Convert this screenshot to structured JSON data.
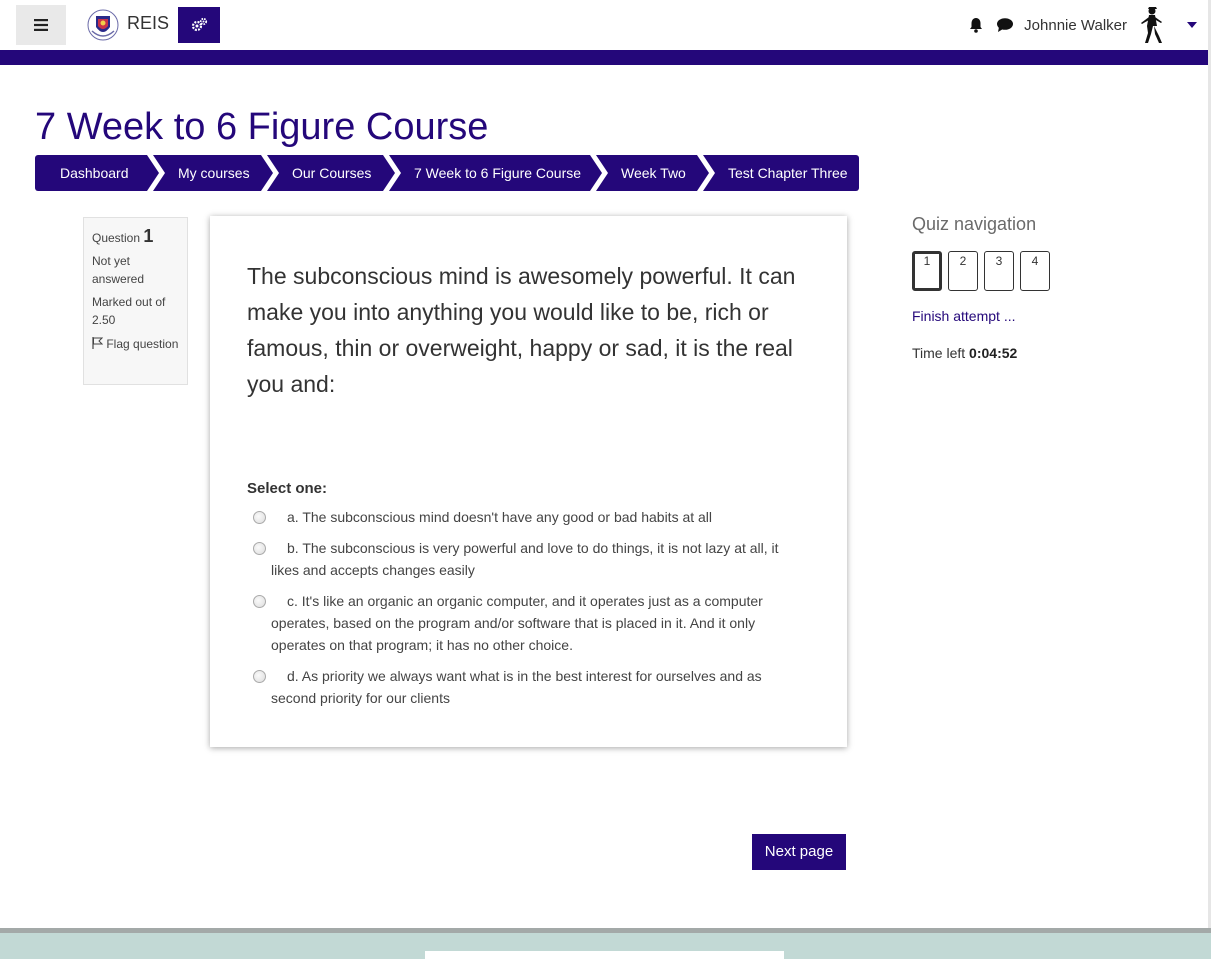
{
  "navbar": {
    "brand_name": "REIS",
    "user_name": "Johnnie Walker"
  },
  "page": {
    "title": "7 Week to 6 Figure Course"
  },
  "breadcrumb": [
    "Dashboard",
    "My courses",
    "Our Courses",
    "7 Week to 6 Figure Course",
    "Week Two",
    "Test Chapter Three"
  ],
  "question_info": {
    "question_label": "Question",
    "question_number": "1",
    "state": "Not yet answered",
    "marks": "Marked out of 2.50",
    "flag_label": "Flag question"
  },
  "question": {
    "text": "The subconscious mind is awesomely powerful. It can make you into anything you would like to be, rich or famous, thin or overweight, happy or sad, it is the real you and:",
    "prompt": "Select one:",
    "answers": [
      "a. The subconscious mind doesn't have any good or bad habits at all",
      "b. The subconscious is very powerful and love to do things, it is not lazy at all, it likes and accepts changes easily",
      "c. It's like an organic an organic computer, and it operates just as a computer operates, based on the program and/or software that is placed in it. And it only operates on that program; it has no other choice.",
      "d. As priority we always want what is in the best interest for ourselves and as second priority for our clients"
    ],
    "next_label": "Next page"
  },
  "quiz_nav": {
    "title": "Quiz navigation",
    "buttons": [
      "1",
      "2",
      "3",
      "4"
    ],
    "current": "1",
    "finish_label": "Finish attempt ...",
    "time_label": "Time left",
    "time_value": "0:04:52"
  },
  "colors": {
    "primary": "#24077a",
    "footer": "#c2d9d5"
  }
}
